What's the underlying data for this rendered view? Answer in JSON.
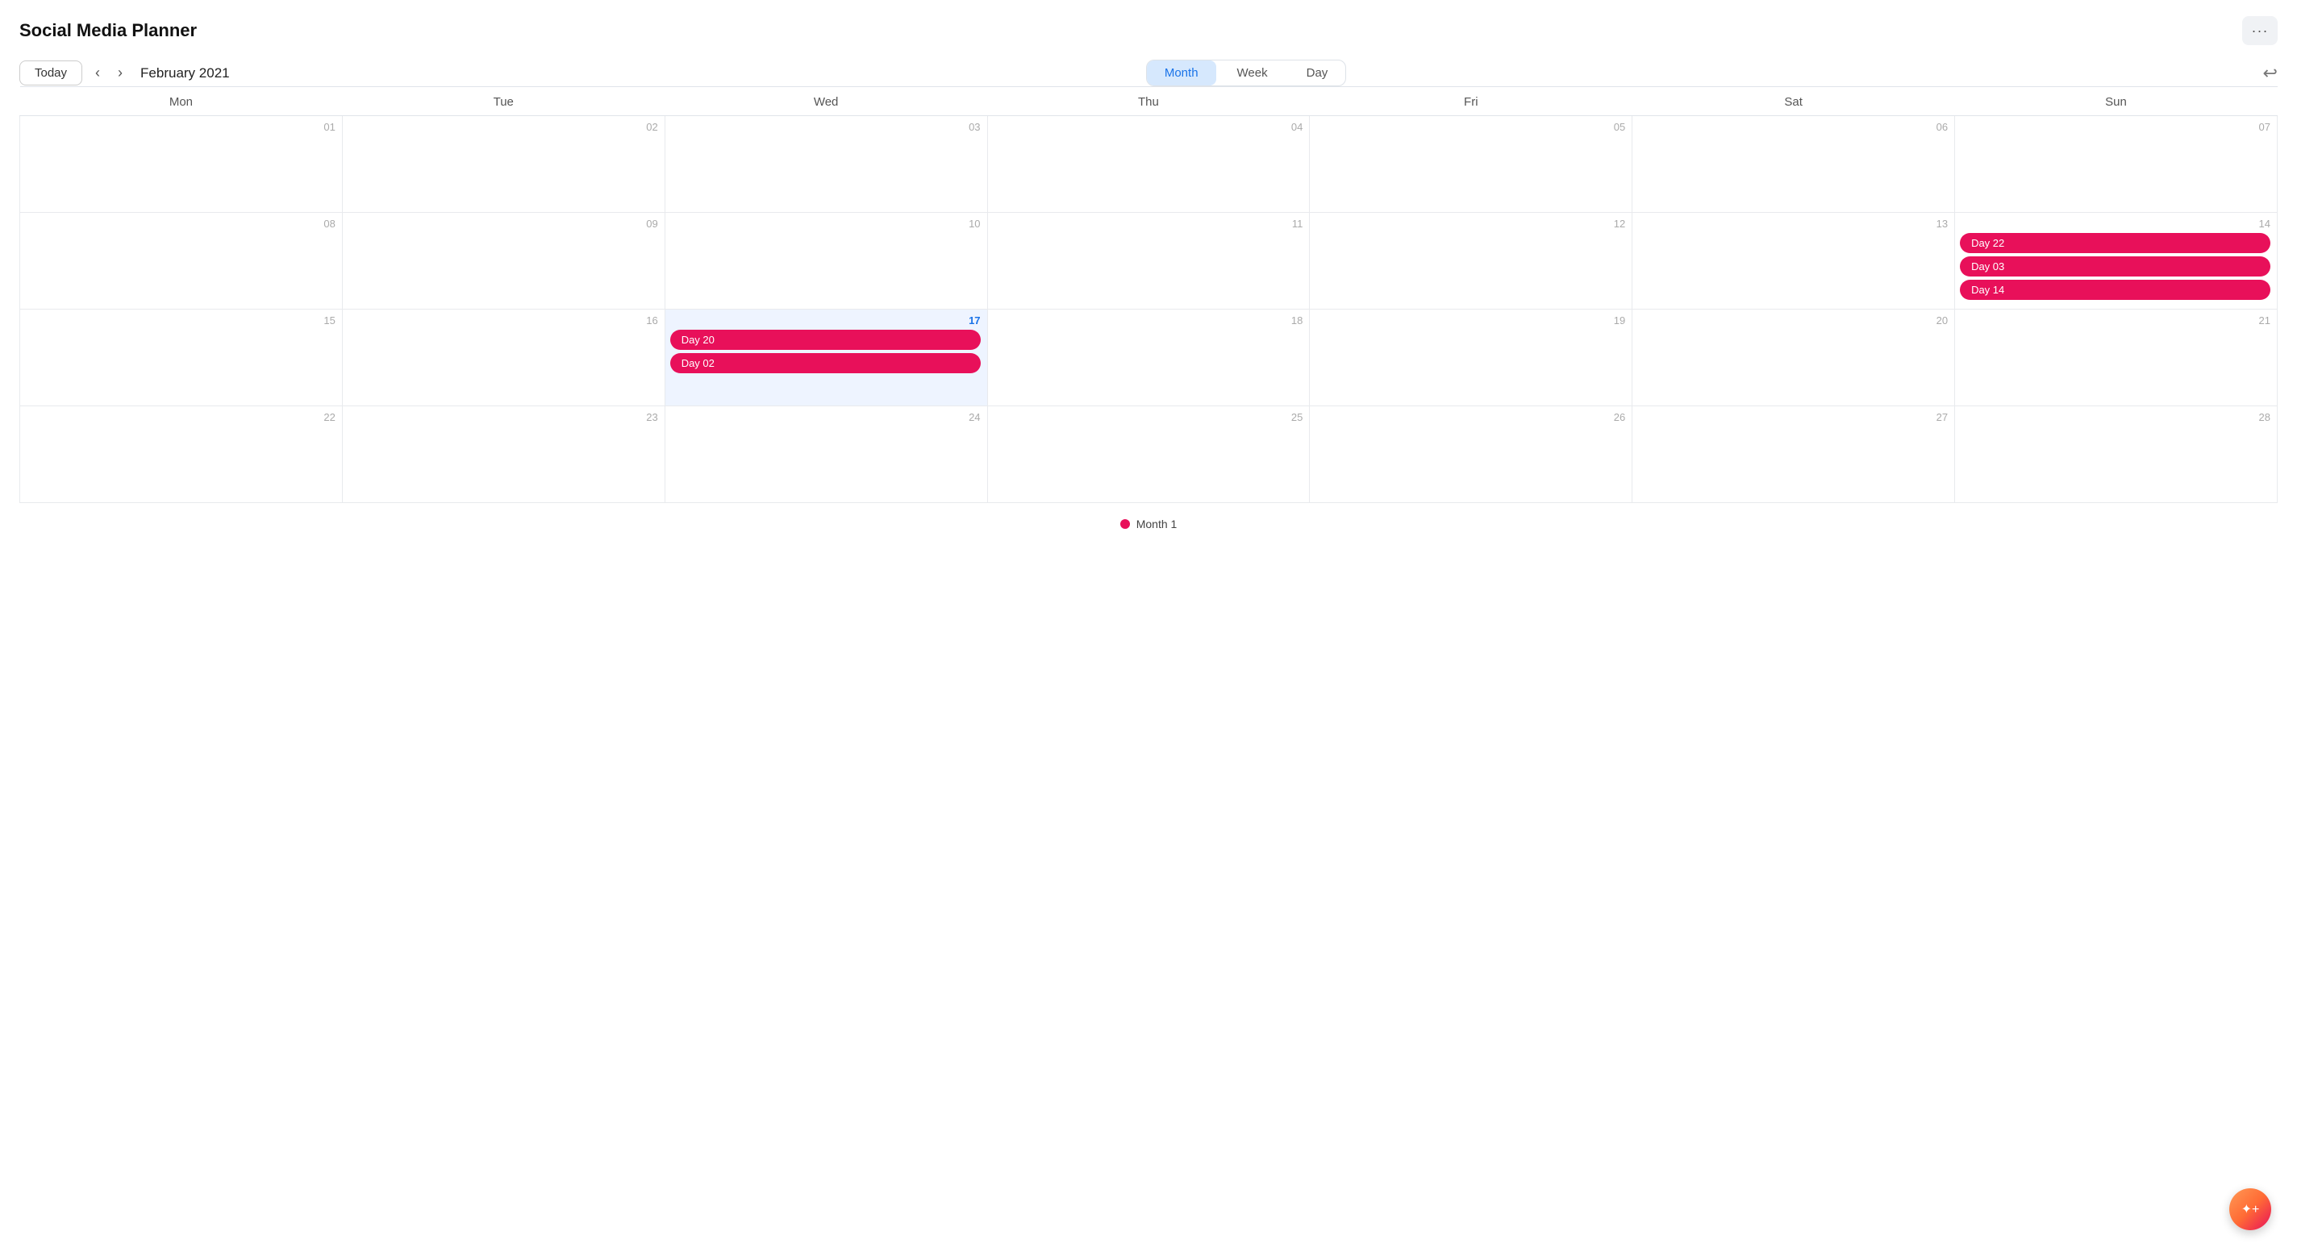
{
  "app": {
    "title": "Social Media Planner"
  },
  "toolbar": {
    "today_label": "Today",
    "current_month": "February 2021",
    "views": [
      "Month",
      "Week",
      "Day"
    ],
    "active_view": "Month"
  },
  "calendar": {
    "day_headers": [
      "Mon",
      "Tue",
      "Wed",
      "Thu",
      "Fri",
      "Sat",
      "Sun"
    ],
    "weeks": [
      [
        {
          "num": "01",
          "events": [],
          "today": false
        },
        {
          "num": "02",
          "events": [],
          "today": false
        },
        {
          "num": "03",
          "events": [],
          "today": false
        },
        {
          "num": "04",
          "events": [],
          "today": false
        },
        {
          "num": "05",
          "events": [],
          "today": false
        },
        {
          "num": "06",
          "events": [],
          "today": false
        },
        {
          "num": "07",
          "events": [],
          "today": false
        }
      ],
      [
        {
          "num": "08",
          "events": [],
          "today": false
        },
        {
          "num": "09",
          "events": [],
          "today": false
        },
        {
          "num": "10",
          "events": [],
          "today": false
        },
        {
          "num": "11",
          "events": [],
          "today": false
        },
        {
          "num": "12",
          "events": [],
          "today": false
        },
        {
          "num": "13",
          "events": [],
          "today": false
        },
        {
          "num": "14",
          "events": [
            "Day 22",
            "Day 03",
            "Day 14"
          ],
          "today": false
        }
      ],
      [
        {
          "num": "15",
          "events": [],
          "today": false
        },
        {
          "num": "16",
          "events": [],
          "today": false
        },
        {
          "num": "17",
          "events": [
            "Day 20",
            "Day 02"
          ],
          "today": true
        },
        {
          "num": "18",
          "events": [],
          "today": false
        },
        {
          "num": "19",
          "events": [],
          "today": false
        },
        {
          "num": "20",
          "events": [],
          "today": false
        },
        {
          "num": "21",
          "events": [],
          "today": false
        }
      ],
      [
        {
          "num": "22",
          "events": [],
          "today": false
        },
        {
          "num": "23",
          "events": [],
          "today": false
        },
        {
          "num": "24",
          "events": [],
          "today": false
        },
        {
          "num": "25",
          "events": [],
          "today": false
        },
        {
          "num": "26",
          "events": [],
          "today": false
        },
        {
          "num": "27",
          "events": [],
          "today": false
        },
        {
          "num": "28",
          "events": [],
          "today": false
        }
      ]
    ]
  },
  "legend": {
    "label": "Month 1"
  },
  "icons": {
    "more": "···",
    "prev": "‹",
    "next": "›",
    "sidebar_toggle": "↩",
    "fab": "✦"
  }
}
